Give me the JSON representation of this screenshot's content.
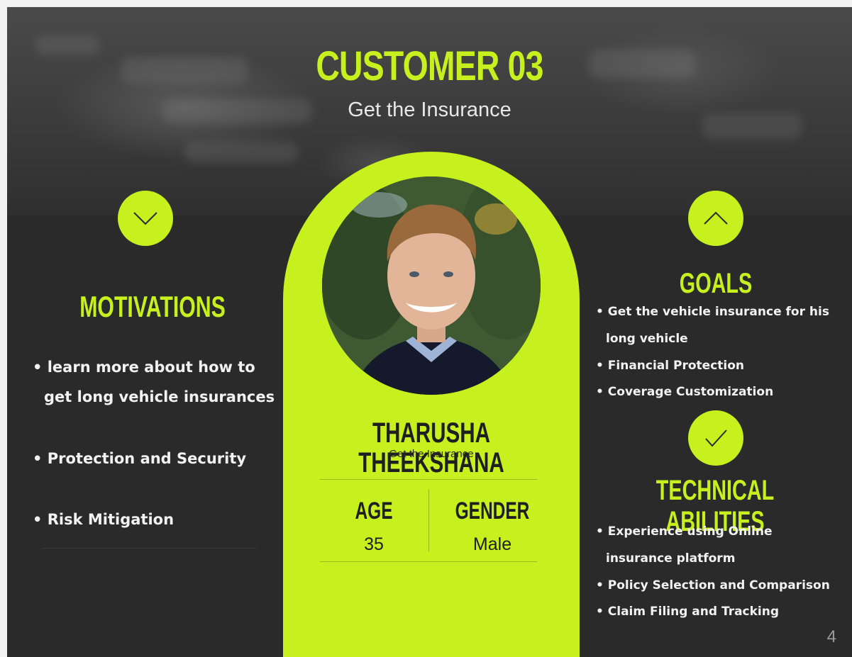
{
  "header": {
    "title": "CUSTOMER 03",
    "subtitle": "Get the Insurance"
  },
  "profile": {
    "name": "THARUSHA THEEKSHANA",
    "role": "Get the Insurance",
    "age_label": "AGE",
    "age_value": "35",
    "gender_label": "GENDER",
    "gender_value": "Male"
  },
  "motivations": {
    "heading": "MOTIVATIONS",
    "icon": "chevron-down-icon",
    "items": [
      "• learn more about how to",
      "get long vehicle insurances",
      "• Protection and Security",
      "• Risk Mitigation"
    ]
  },
  "goals": {
    "heading": "GOALS",
    "icon": "chevron-up-icon",
    "items": [
      "•  Get the vehicle insurance for his",
      "long vehicle",
      "• Financial Protection",
      "• Coverage Customization"
    ]
  },
  "technical": {
    "heading": "TECHNICAL ABILITIES",
    "icon": "checkmark-icon",
    "items": [
      "• Experience using Online",
      "insurance platform",
      "• Policy Selection and Comparison",
      "• Claim Filing and Tracking"
    ]
  },
  "page_number": "4",
  "colors": {
    "accent": "#c6f01e",
    "panel": "#2a2a2a",
    "text_light": "#f2f2f2"
  }
}
